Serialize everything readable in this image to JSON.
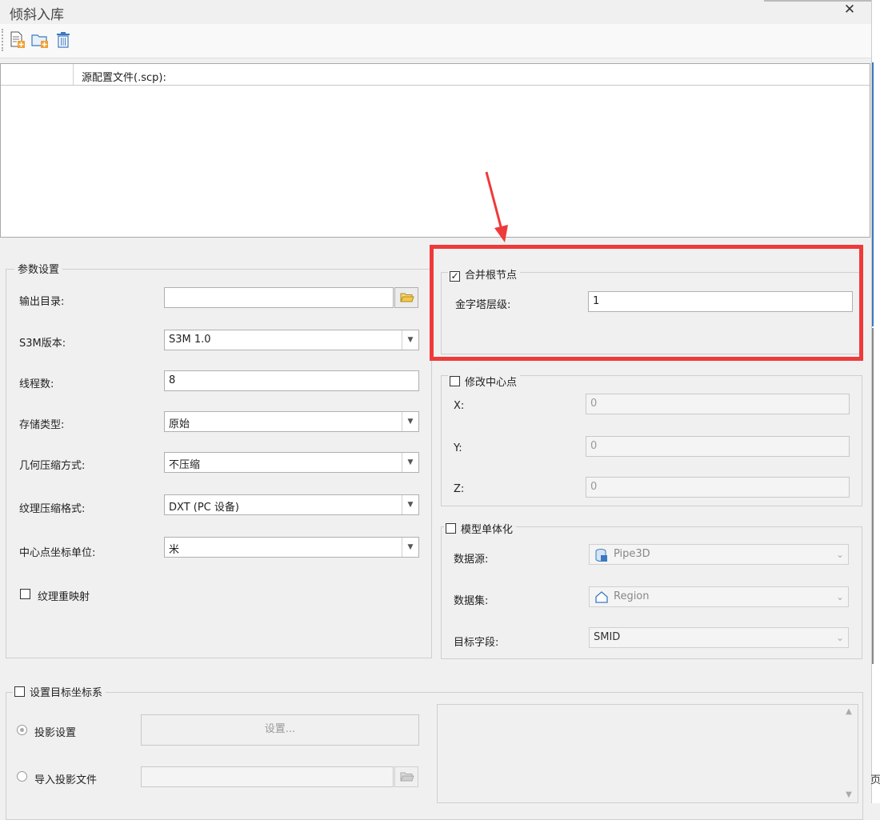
{
  "window": {
    "title": "倾斜入库",
    "close_glyph": "✕"
  },
  "toolbar": {
    "buttons": [
      "new-file-icon",
      "add-folder-icon",
      "delete-icon"
    ]
  },
  "file_list": {
    "column_header": "源配置文件(.scp):"
  },
  "params": {
    "group_label": "参数设置",
    "output_dir": {
      "label": "输出目录:",
      "value": ""
    },
    "s3m_version": {
      "label": "S3M版本:",
      "value": "S3M 1.0"
    },
    "threads": {
      "label": "线程数:",
      "value": "8"
    },
    "storage_type": {
      "label": "存储类型:",
      "value": "原始"
    },
    "geometry_compression": {
      "label": "几何压缩方式:",
      "value": "不压缩"
    },
    "texture_compression": {
      "label": "纹理压缩格式:",
      "value": "DXT (PC 设备)"
    },
    "center_unit": {
      "label": "中心点坐标单位:",
      "value": "米"
    },
    "texture_remap": {
      "label": "纹理重映射",
      "checked": false
    }
  },
  "merge_root": {
    "label": "合并根节点",
    "checked": true,
    "check_glyph": "✓",
    "pyramid_level": {
      "label": "金字塔层级:",
      "value": "1"
    }
  },
  "modify_center": {
    "label": "修改中心点",
    "checked": false,
    "x": {
      "label": "X:",
      "value": "0"
    },
    "y": {
      "label": "Y:",
      "value": "0"
    },
    "z": {
      "label": "Z:",
      "value": "0"
    }
  },
  "model_entity": {
    "label": "模型单体化",
    "checked": false,
    "datasource": {
      "label": "数据源:",
      "value": "Pipe3D"
    },
    "dataset": {
      "label": "数据集:",
      "value": "Region"
    },
    "target_field": {
      "label": "目标字段:",
      "value": "SMID"
    }
  },
  "target_crs": {
    "label": "设置目标坐标系",
    "checked": false,
    "projection_settings": {
      "label": "投影设置",
      "button": "设置..."
    },
    "import_projection": {
      "label": "导入投影文件",
      "value": ""
    }
  },
  "edge_text": "页",
  "colors": {
    "highlight_red": "#ef3a3a",
    "accent_blue": "#3b78c2"
  }
}
